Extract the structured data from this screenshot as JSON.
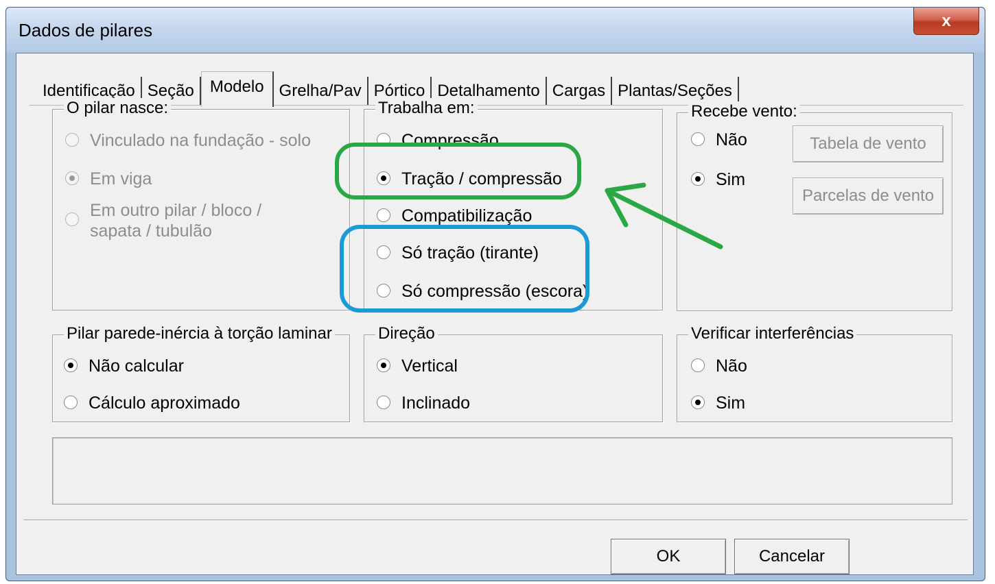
{
  "window": {
    "title": "Dados de pilares",
    "close_glyph": "x"
  },
  "tabs": [
    {
      "label": "Identificação"
    },
    {
      "label": "Seção"
    },
    {
      "label": "Modelo"
    },
    {
      "label": "Grelha/Pav"
    },
    {
      "label": "Pórtico"
    },
    {
      "label": "Detalhamento"
    },
    {
      "label": "Cargas"
    },
    {
      "label": "Plantas/Seções"
    }
  ],
  "active_tab": "Modelo",
  "pilar_nasce": {
    "label": "O pilar nasce:",
    "options": [
      {
        "label": "Vinculado na fundação - solo",
        "selected": false
      },
      {
        "label": "Em viga",
        "selected": true
      },
      {
        "label_line1": "Em outro pilar / bloco /",
        "label_line2": "sapata / tubulão",
        "selected": false
      }
    ]
  },
  "trabalha_em": {
    "label": "Trabalha em:",
    "options": [
      {
        "label": "Compressão",
        "selected": false
      },
      {
        "label": "Tração / compressão",
        "selected": true
      },
      {
        "label": "Compatibilização",
        "selected": false
      },
      {
        "label": "Só tração (tirante)",
        "selected": false
      },
      {
        "label": "Só compressão (escora)",
        "selected": false
      }
    ]
  },
  "recebe_vento": {
    "label": "Recebe vento:",
    "options": [
      {
        "label": "Não",
        "selected": false
      },
      {
        "label": "Sim",
        "selected": true
      }
    ],
    "tabela_button": "Tabela de vento",
    "parcelas_button": "Parcelas de vento"
  },
  "pilar_parede": {
    "label": "Pilar parede-inércia à torção laminar",
    "options": [
      {
        "label": "Não calcular",
        "selected": true
      },
      {
        "label": "Cálculo aproximado",
        "selected": false
      }
    ]
  },
  "direcao": {
    "label": "Direção",
    "options": [
      {
        "label": "Vertical",
        "selected": true
      },
      {
        "label": "Inclinado",
        "selected": false
      }
    ]
  },
  "verificar": {
    "label": "Verificar interferências",
    "options": [
      {
        "label": "Não",
        "selected": false
      },
      {
        "label": "Sim",
        "selected": true
      }
    ]
  },
  "footer": {
    "ok_label": "OK",
    "cancel_label": "Cancelar"
  },
  "annotation_colors": {
    "green": "#2aa845",
    "blue": "#1a9ad6"
  }
}
